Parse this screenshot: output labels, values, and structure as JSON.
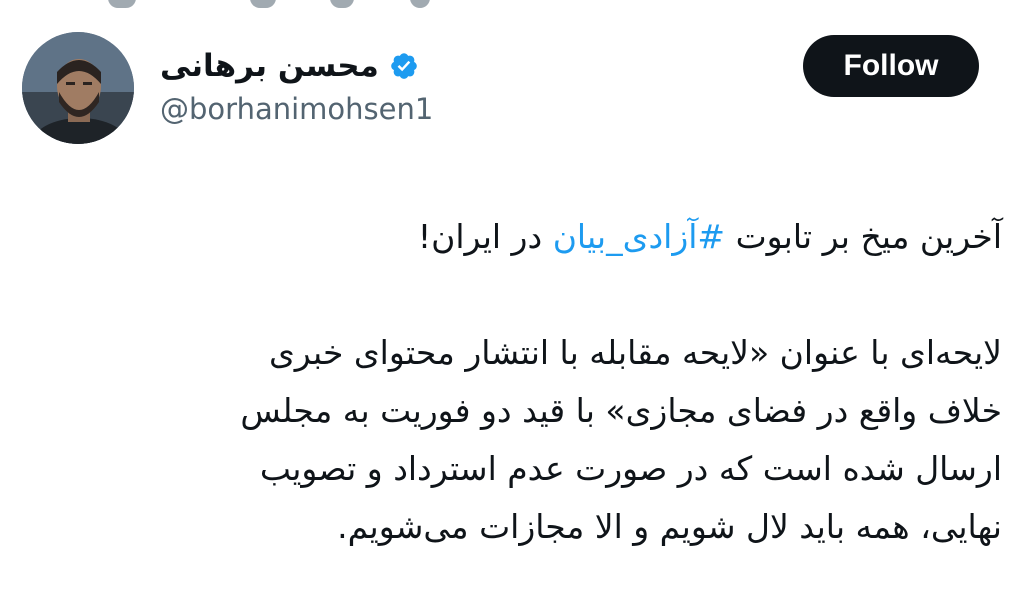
{
  "tweet": {
    "author": {
      "display_name": "محسن برهانی",
      "handle": "@borhanimohsen1",
      "verified_icon": "verified-badge-icon",
      "avatar_icon": "avatar-photo"
    },
    "follow_label": "Follow",
    "intro": {
      "before": "آخرین میخ بر تابوت ",
      "hashtag": "#آزادی_بیان",
      "after": " در ایران!"
    },
    "paragraph_lines": [
      "لایحه‌ای با عنوان «لایحه مقابله با انتشار محتوای خبری",
      "خلاف واقع در فضای مجازی» با قید دو فوریت به مجلس",
      "ارسال شده است که در صورت عدم استرداد و تصویب",
      "نهایی، همه باید لال شویم و الا مجازات می‌شویم."
    ]
  },
  "colors": {
    "text_primary": "#0f1419",
    "text_secondary": "#536471",
    "accent_blue": "#1d9bf0",
    "button_bg": "#0f1419",
    "button_text": "#ffffff"
  }
}
